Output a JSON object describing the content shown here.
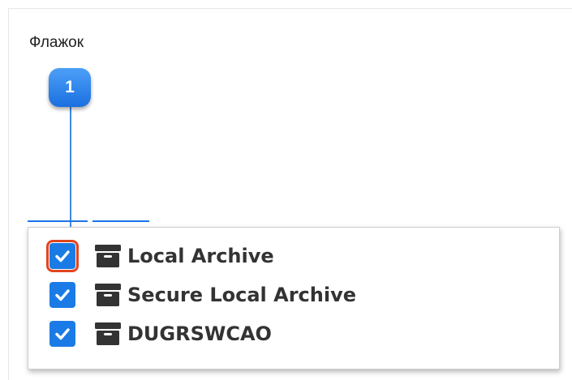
{
  "heading": "Флажок",
  "callout": {
    "number": "1"
  },
  "options": [
    {
      "label": "Local Archive",
      "checked": true,
      "highlighted": true,
      "icon": "archive-box-icon"
    },
    {
      "label": "Secure Local Archive",
      "checked": true,
      "highlighted": false,
      "icon": "archive-box-icon"
    },
    {
      "label": "DUGRSWCAO",
      "checked": true,
      "highlighted": false,
      "icon": "archive-box-icon"
    }
  ],
  "colors": {
    "accent": "#1b7be6",
    "highlight": "#e2451f",
    "callout": "#1a6fe0",
    "text": "#333333"
  }
}
